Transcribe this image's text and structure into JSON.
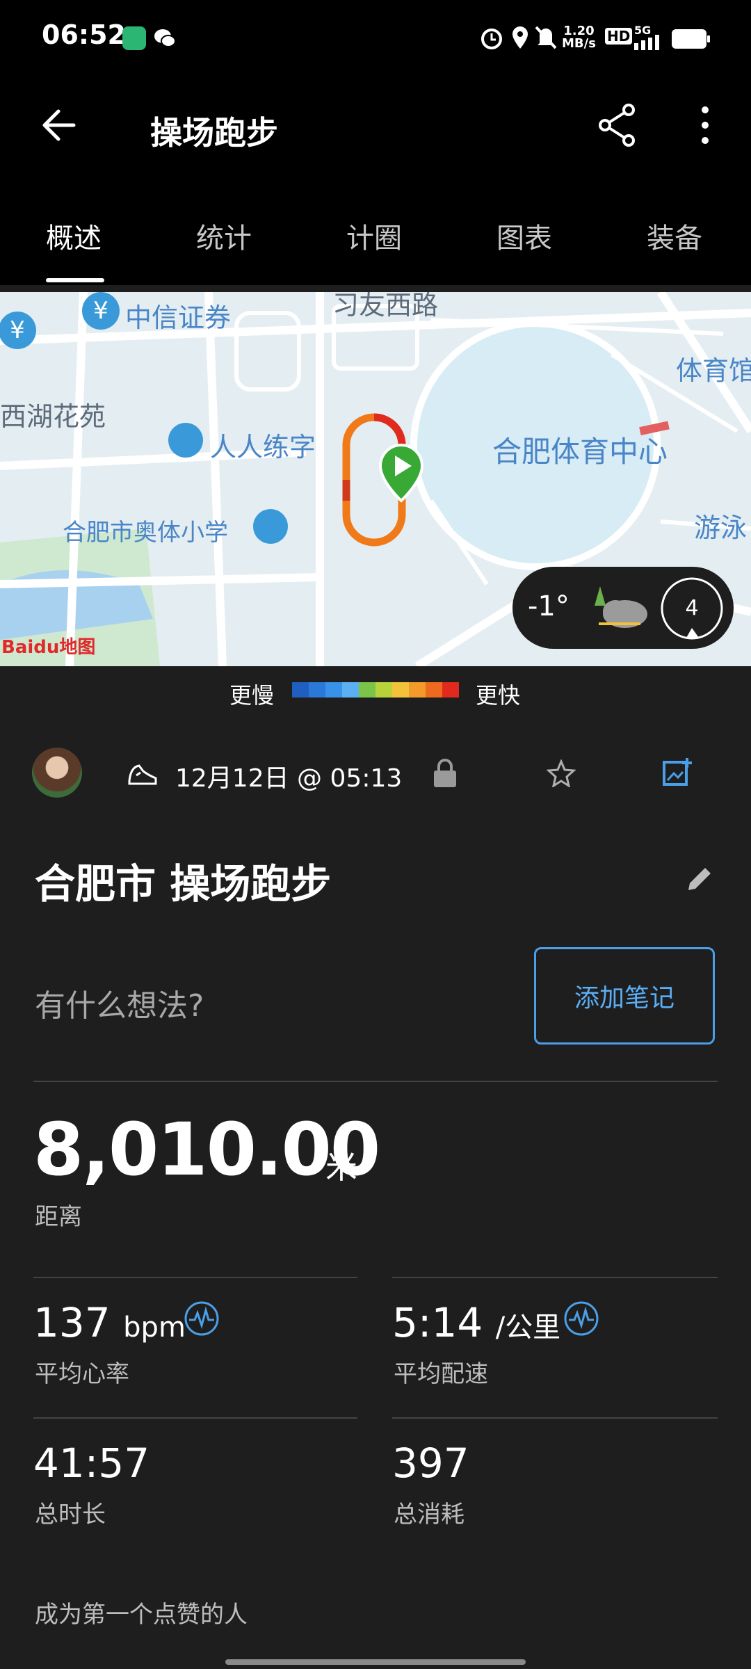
{
  "status_bar": {
    "time": "06:52",
    "network_speed": "1.20",
    "network_speed_unit": "MB/s",
    "hd_label": "HD",
    "signal_label": "5G"
  },
  "app_bar": {
    "title": "操场跑步",
    "tabs": [
      "概述",
      "统计",
      "计圈",
      "图表",
      "装备"
    ]
  },
  "map": {
    "labels": [
      "习友西路",
      "中信证券",
      "西湖花苑",
      "人人练字",
      "合肥市奥体小学",
      "合肥体育中心",
      "体育馆",
      "游泳"
    ],
    "provider": "Baidu地图",
    "temperature": "-1°",
    "wind_speed": "4"
  },
  "pace_legend": {
    "slower": "更慢",
    "faster": "更快",
    "colors": [
      "#1f5fc0",
      "#2a78d8",
      "#3a92e8",
      "#5ab0f0",
      "#7cc34a",
      "#b8d33a",
      "#f2c23a",
      "#f29a2a",
      "#ee6a1e",
      "#e02a1e"
    ]
  },
  "activity": {
    "datetime": "12月12日 @ 05:13",
    "title": "合肥市 操场跑步",
    "thought_placeholder": "有什么想法?",
    "add_note_label": "添加笔记",
    "distance": "8,010.00",
    "distance_unit": "米",
    "distance_label": "距离",
    "stats": [
      {
        "value": "137",
        "unit": "bpm",
        "label": "平均心率"
      },
      {
        "value": "5:14",
        "unit": "/公里",
        "label": "平均配速"
      },
      {
        "value": "41:57",
        "unit": "",
        "label": "总时长"
      },
      {
        "value": "397",
        "unit": "",
        "label": "总消耗"
      }
    ],
    "first_like": "成为第一个点赞的人"
  },
  "colors": {
    "accent": "#4a9fe8",
    "route": "#f07a1a",
    "start_marker": "#39a935"
  }
}
